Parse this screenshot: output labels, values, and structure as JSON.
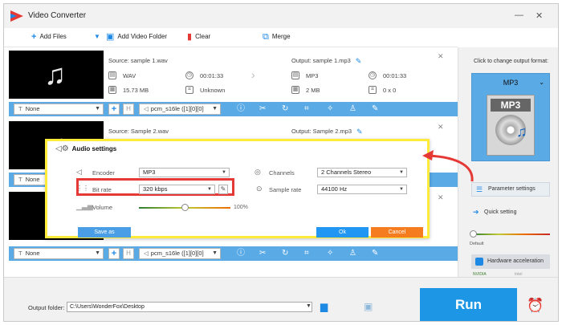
{
  "window": {
    "title": "Video Converter",
    "minimize_icon": "minimize-icon",
    "close_icon": "close-icon"
  },
  "toolbar": {
    "add_files": "Add Files",
    "add_video_folder": "Add Video Folder",
    "clear": "Clear",
    "merge": "Merge"
  },
  "files": [
    {
      "source": "Source: sample 1.wav",
      "src_format": "WAV",
      "src_duration": "00:01:33",
      "src_size": "15.73 MB",
      "src_resolution": "Unknown",
      "output": "Output: sample 1.mp3",
      "out_format": "MP3",
      "out_duration": "00:01:33",
      "out_size": "2 MB",
      "out_resolution": "0 x 0"
    },
    {
      "source": "Source: Sample 2.wav",
      "output": "Output: Sample 2.mp3"
    }
  ],
  "controlbar": {
    "subtitle": "None",
    "audio_track": "pcm_s16le ([1][0][0]"
  },
  "right_panel": {
    "hint": "Click to change output format:",
    "format": "MP3",
    "format_icon_label": "MP3",
    "parameter_settings": "Parameter settings",
    "quick_setting": "Quick setting",
    "quick_default": "Default",
    "hardware_acceleration": "Hardware acceleration",
    "nvidia": "NVIDIA",
    "intel": "Intel"
  },
  "dialog": {
    "title": "Audio settings",
    "encoder_label": "Encoder",
    "encoder_value": "MP3",
    "bitrate_label": "Bit rate",
    "bitrate_value": "320 kbps",
    "volume_label": "Volume",
    "volume_pct": "100%",
    "volume_level": 0.5,
    "channels_label": "Channels",
    "channels_value": "2 Channels Stereo",
    "sample_rate_label": "Sample rate",
    "sample_rate_value": "44100 Hz",
    "save_as": "Save as",
    "ok": "Ok",
    "cancel": "Cancel"
  },
  "bottom": {
    "output_folder_label": "Output folder:",
    "output_folder_value": "C:\\Users\\WonderFox\\Desktop",
    "run": "Run"
  },
  "colors": {
    "accent": "#1e96e6",
    "controlbar": "#5aaae6",
    "highlight_yellow": "#ffeb3b",
    "highlight_red": "#e53935",
    "cancel": "#f57c1f"
  }
}
